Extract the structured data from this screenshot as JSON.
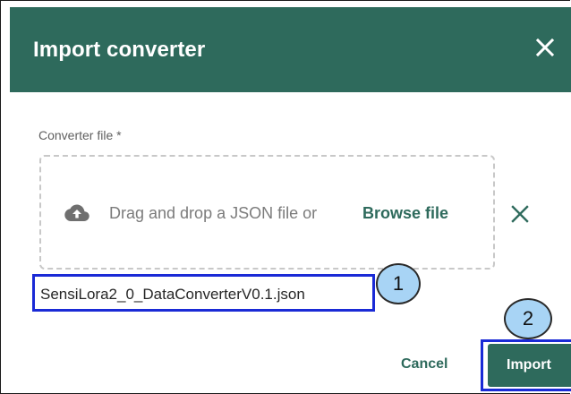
{
  "dialog": {
    "title": "Import converter",
    "close_icon": "close-icon"
  },
  "form": {
    "field_label": "Converter file *",
    "dropzone": {
      "icon": "cloud-upload-icon",
      "text": "Drag and drop a JSON file or",
      "browse_label": "Browse file"
    },
    "clear_icon": "clear-icon",
    "selected_file": "SensiLora2_0_DataConverterV0.1.json"
  },
  "callouts": {
    "first": "1",
    "second": "2"
  },
  "actions": {
    "cancel_label": "Cancel",
    "import_label": "Import"
  },
  "colors": {
    "accent": "#2e6a5c",
    "highlight": "#1a2ad6",
    "callout_fill": "#a8d4f5"
  }
}
